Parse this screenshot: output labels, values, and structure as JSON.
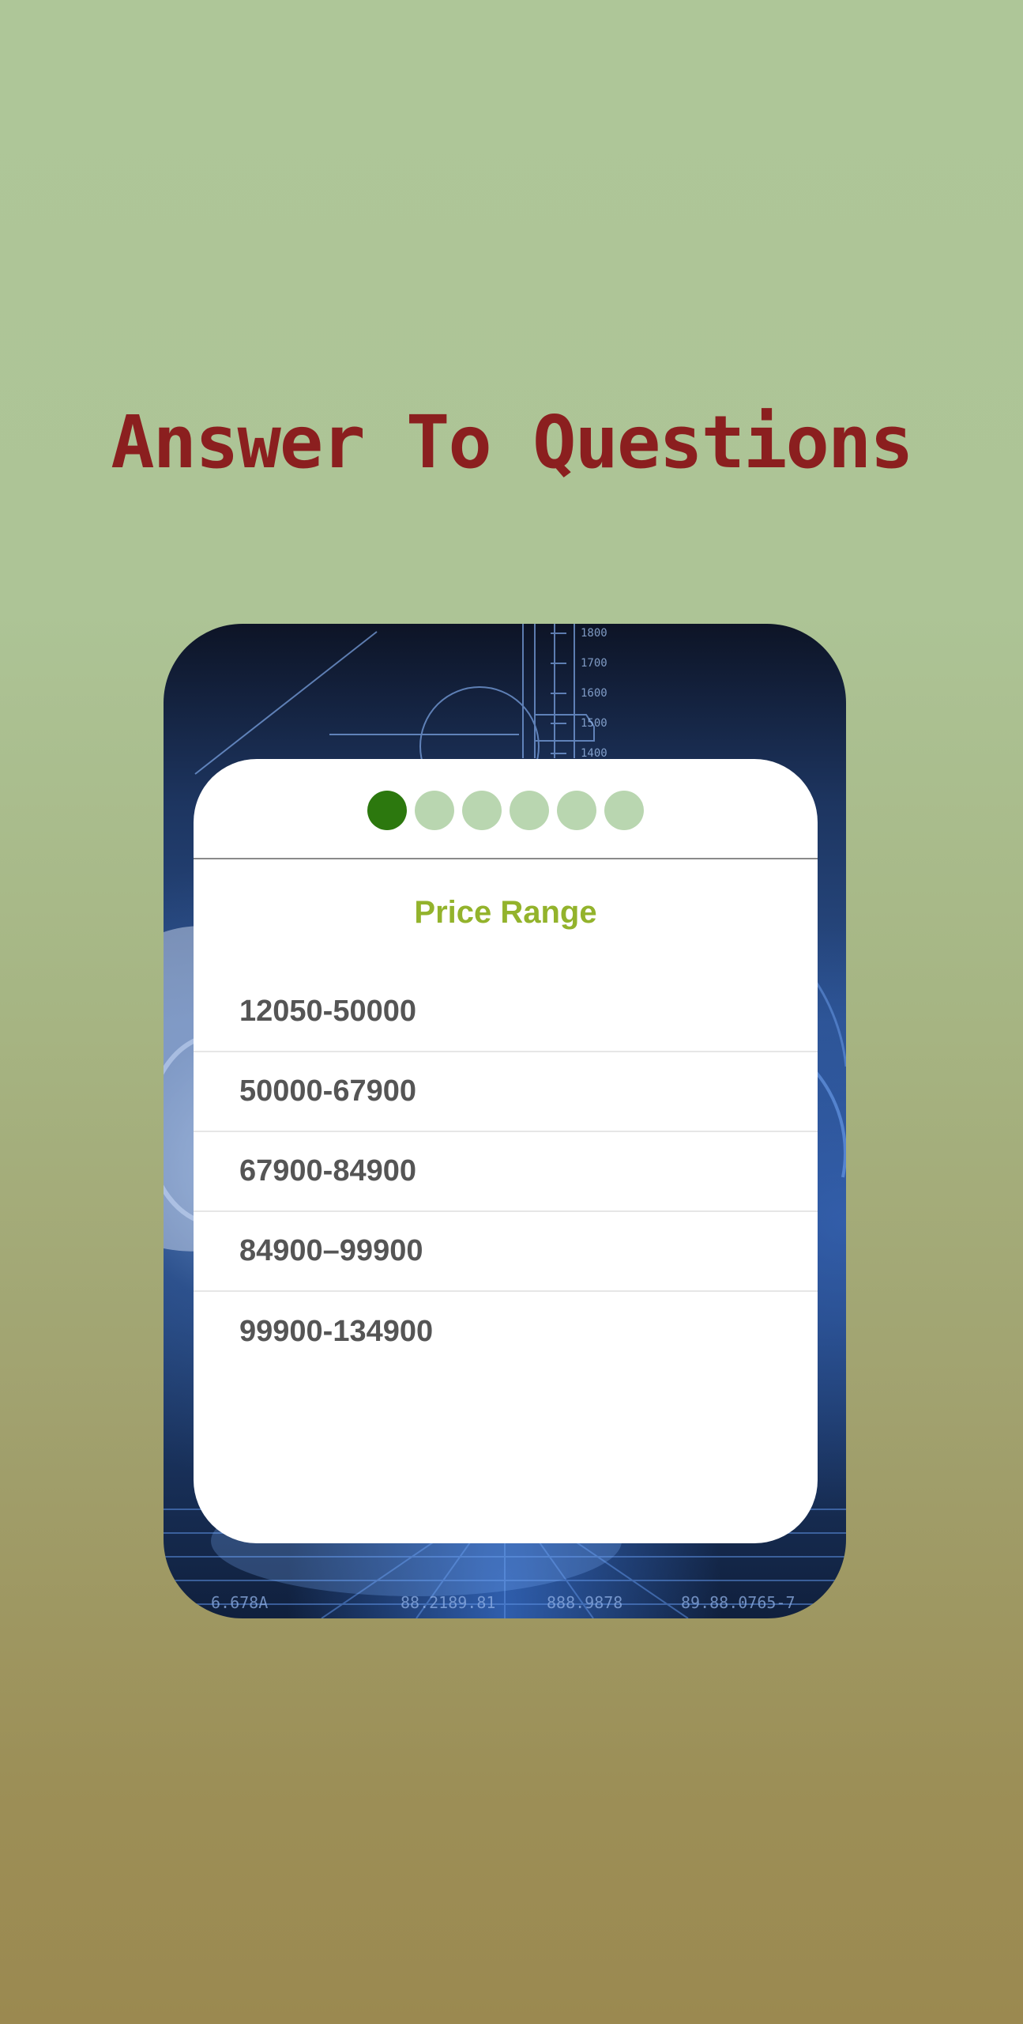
{
  "page": {
    "title": "Answer To Questions"
  },
  "quiz": {
    "steps": [
      {
        "state": "active"
      },
      {
        "state": "inactive"
      },
      {
        "state": "inactive"
      },
      {
        "state": "inactive"
      },
      {
        "state": "inactive"
      },
      {
        "state": "inactive"
      }
    ],
    "question": "Price Range",
    "options": [
      "12050-50000",
      "50000-67900",
      "67900-84900",
      "84900–99900",
      "99900-134900"
    ]
  },
  "background": {
    "hud_numbers": [
      "1800",
      "1700",
      "1600",
      "1500",
      "1400"
    ],
    "footer_readouts": [
      "6.678A",
      "88.2189.81",
      "888.9878",
      "89.88.0765-7"
    ]
  },
  "colors": {
    "title": "#8b1f1f",
    "question": "#93b32c",
    "active_step": "#2c780e",
    "inactive_step": "#b9d6b0",
    "option_text": "#555555"
  }
}
